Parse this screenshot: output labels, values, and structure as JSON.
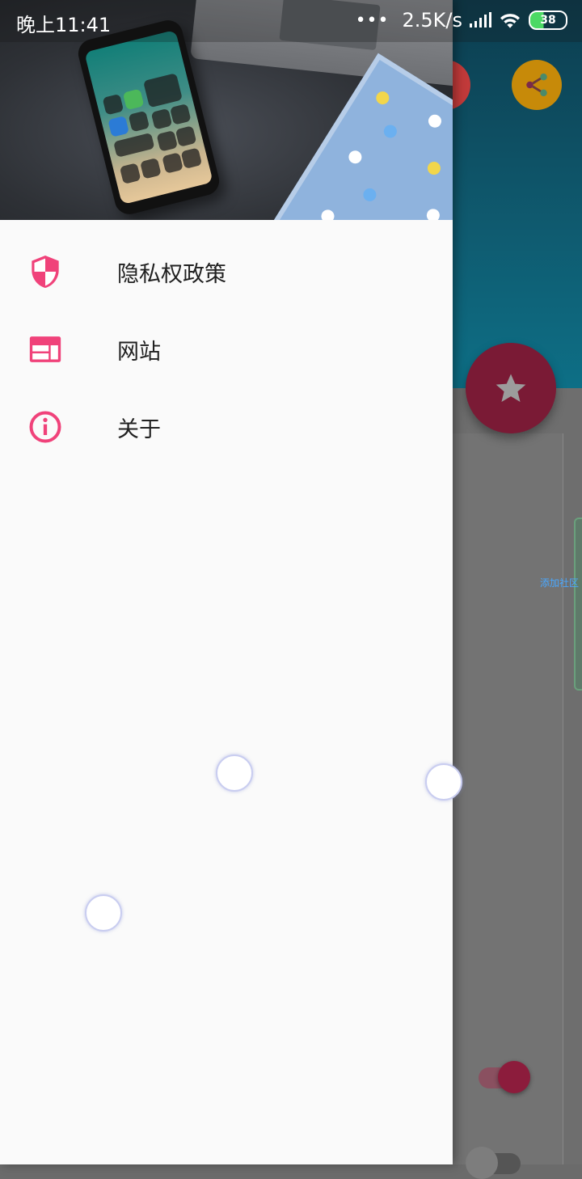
{
  "status_bar": {
    "time": "晚上11:41",
    "dots": "•••",
    "network_speed": "2.5K/s",
    "battery_level": "38"
  },
  "background_app": {
    "link_text": "添加社区",
    "accent_color": "#7a1a35"
  },
  "drawer": {
    "menu": [
      {
        "icon": "shield-icon",
        "label": "隐私权政策"
      },
      {
        "icon": "web-icon",
        "label": "网站"
      },
      {
        "icon": "info-icon",
        "label": "关于"
      }
    ],
    "icon_color": "#f0427a"
  }
}
